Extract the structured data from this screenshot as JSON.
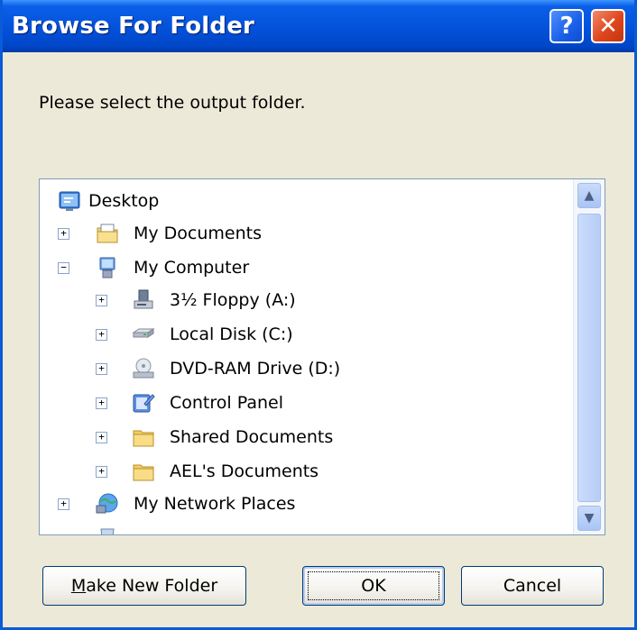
{
  "window": {
    "title": "Browse For Folder",
    "help_glyph": "?",
    "close_glyph": "✕"
  },
  "prompt": "Please select the output folder.",
  "tree": {
    "items": [
      {
        "label": "Desktop",
        "icon": "desktop-icon",
        "expander": ""
      },
      {
        "label": "My Documents",
        "icon": "my-documents-icon",
        "expander": "+"
      },
      {
        "label": "My Computer",
        "icon": "my-computer-icon",
        "expander": "−"
      },
      {
        "label": "3½ Floppy (A:)",
        "icon": "floppy-drive-icon",
        "expander": "+"
      },
      {
        "label": "Local Disk (C:)",
        "icon": "hard-disk-icon",
        "expander": "+"
      },
      {
        "label": "DVD-RAM Drive (D:)",
        "icon": "dvd-drive-icon",
        "expander": "+"
      },
      {
        "label": "Control Panel",
        "icon": "control-panel-icon",
        "expander": "+"
      },
      {
        "label": "Shared Documents",
        "icon": "folder-icon",
        "expander": "+"
      },
      {
        "label": "AEL's Documents",
        "icon": "folder-icon",
        "expander": "+"
      },
      {
        "label": "My Network Places",
        "icon": "network-places-icon",
        "expander": "+"
      }
    ]
  },
  "scrollbar": {
    "up_glyph": "▲",
    "down_glyph": "▼"
  },
  "buttons": {
    "make_new_folder_first": "M",
    "make_new_folder_rest": "ake New Folder",
    "ok": "OK",
    "cancel": "Cancel"
  },
  "colors": {
    "titlebar": "#0453dc",
    "dialog_bg": "#ece9d8",
    "close_button": "#e0451c"
  }
}
